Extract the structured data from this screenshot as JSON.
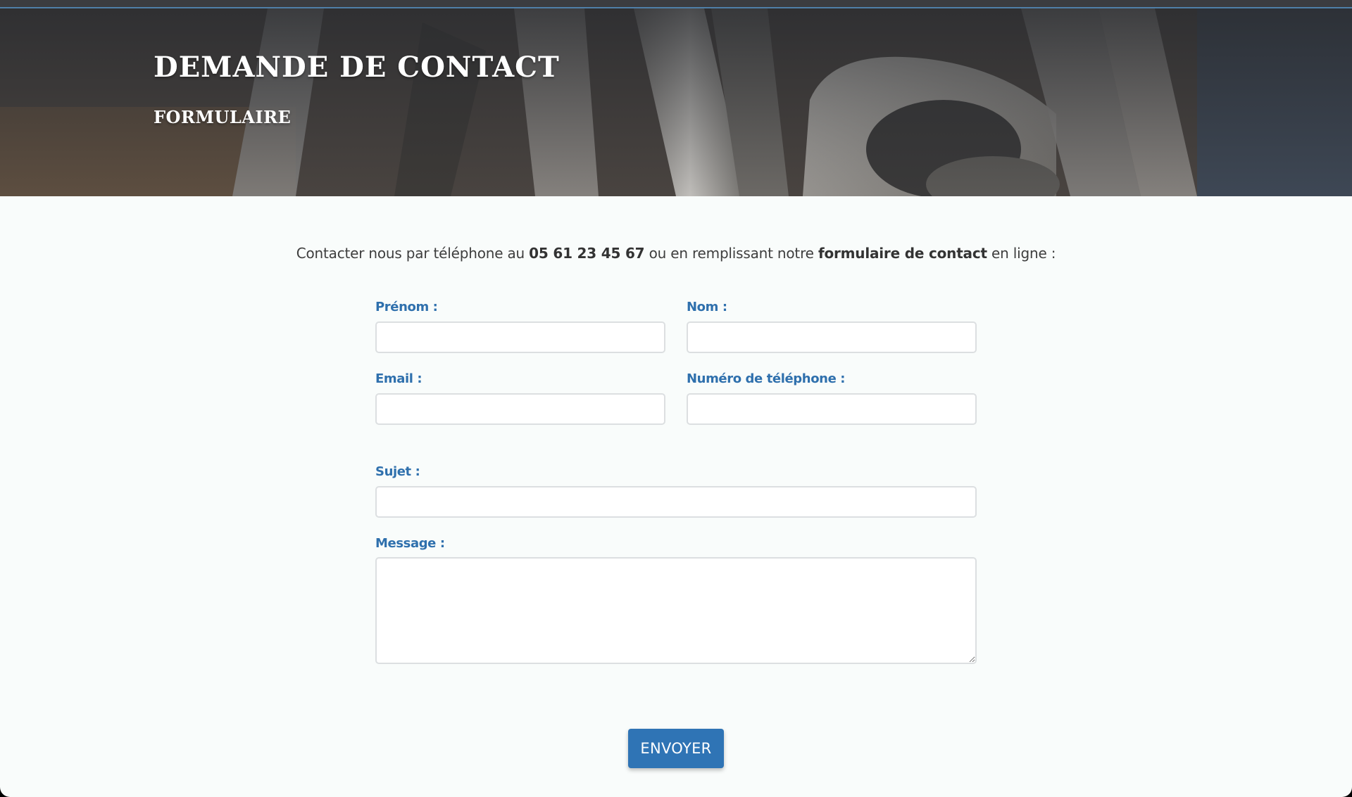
{
  "header": {
    "title": "DEMANDE DE CONTACT",
    "subtitle": "FORMULAIRE"
  },
  "intro": {
    "prefix": "Contacter nous par téléphone au",
    "phone": "05 61 23 45 67",
    "middle": "ou en remplissant notre",
    "form_link": "formulaire de contact",
    "suffix": "en ligne :"
  },
  "form": {
    "first_name": {
      "label": "Prénom :",
      "value": ""
    },
    "last_name": {
      "label": "Nom :",
      "value": ""
    },
    "email": {
      "label": "Email :",
      "value": ""
    },
    "phone": {
      "label": "Numéro de téléphone :",
      "value": ""
    },
    "subject": {
      "label": "Sujet :",
      "value": ""
    },
    "message": {
      "label": "Message :",
      "value": ""
    },
    "submit_label": "ENVOYER"
  },
  "colors": {
    "label": "#2f70ad",
    "button": "#2f74b5",
    "background": "#f9fcfb"
  }
}
